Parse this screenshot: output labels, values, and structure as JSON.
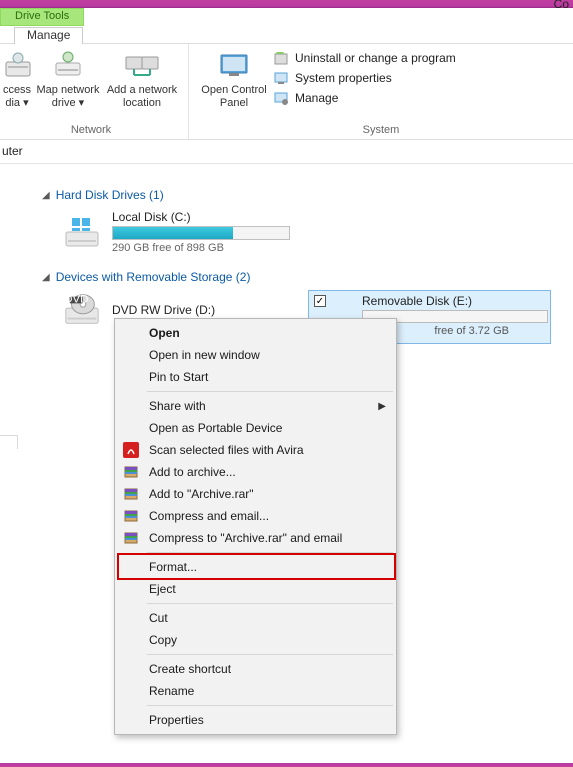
{
  "titlebar": {
    "right_text": "Co"
  },
  "tabs": {
    "drive_tools": "Drive Tools",
    "manage": "Manage"
  },
  "ribbon": {
    "network": {
      "access_media": "ccess\n dia ▾",
      "map_network_drive": "Map network\ndrive ▾",
      "add_network_location": "Add a network\nlocation",
      "group_label": "Network"
    },
    "system": {
      "open_control_panel": "Open Control\nPanel",
      "uninstall": "Uninstall or change a program",
      "system_properties": "System properties",
      "manage": "Manage",
      "group_label": "System"
    }
  },
  "address": "uter",
  "sections": {
    "hdd": {
      "title": "Hard Disk Drives (1)"
    },
    "removable": {
      "title": "Devices with Removable Storage (2)"
    }
  },
  "drives": {
    "local": {
      "name": "Local Disk (C:)",
      "free": "290 GB free of 898 GB",
      "fill_pct": 68
    },
    "dvd": {
      "name": "DVD RW Drive (D:)"
    },
    "removable": {
      "name": "Removable Disk (E:)",
      "free": "free of 3.72 GB"
    }
  },
  "context_menu": {
    "open": "Open",
    "open_new_window": "Open in new window",
    "pin_to_start": "Pin to Start",
    "share_with": "Share with",
    "open_portable": "Open as Portable Device",
    "scan_avira": "Scan selected files with Avira",
    "add_archive": "Add to archive...",
    "add_archive_rar": "Add to \"Archive.rar\"",
    "compress_email": "Compress and email...",
    "compress_archive_email": "Compress to \"Archive.rar\" and email",
    "format": "Format...",
    "eject": "Eject",
    "cut": "Cut",
    "copy": "Copy",
    "create_shortcut": "Create shortcut",
    "rename": "Rename",
    "properties": "Properties"
  }
}
